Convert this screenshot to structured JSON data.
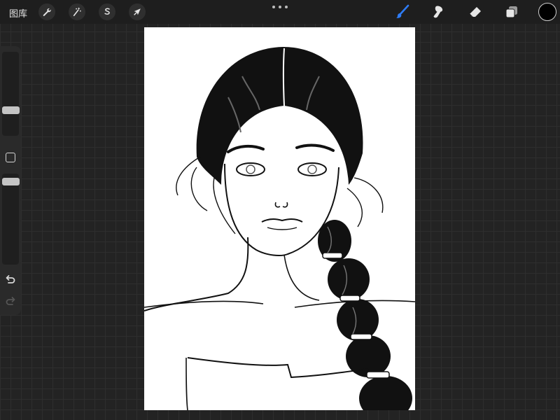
{
  "topbar": {
    "gallery_label": "图库"
  },
  "icons": {
    "actions": "wrench-icon",
    "adjustments": "magic-wand-icon",
    "selection": "selection-s-icon",
    "transform": "arrow-cursor-icon",
    "more": "ellipsis-icon",
    "brush": "brush-icon",
    "smudge": "smudge-icon",
    "eraser": "eraser-icon",
    "layers": "layers-icon",
    "undo": "undo-arrow-icon",
    "redo": "redo-arrow-icon"
  },
  "colors": {
    "brush_active": "#2e7cf6",
    "current_color": "#000000"
  },
  "sidebar": {
    "brush_size_level": 0.28,
    "opacity_level": 0.95
  }
}
